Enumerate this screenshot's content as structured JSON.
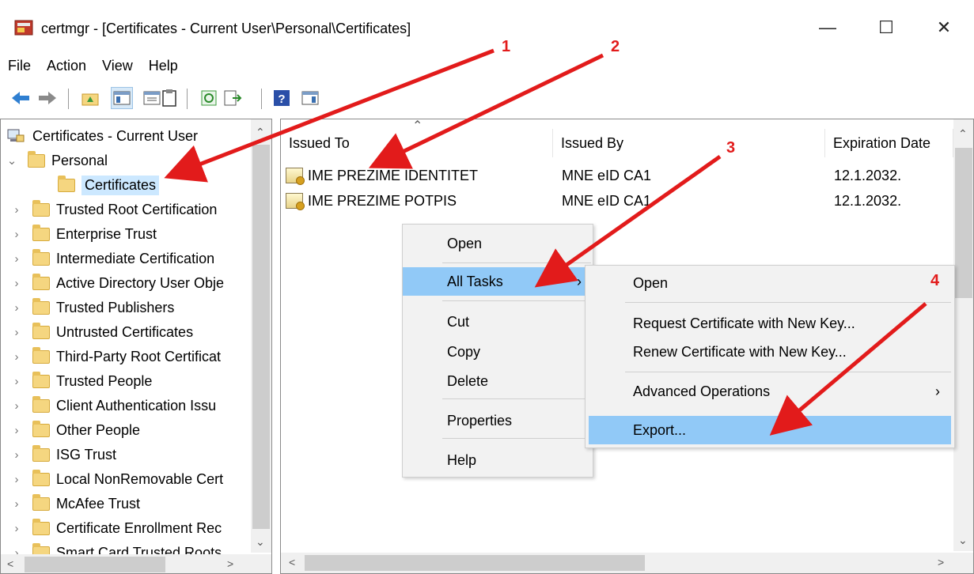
{
  "window": {
    "title": "certmgr - [Certificates - Current User\\Personal\\Certificates]",
    "minimize_glyph": "—",
    "maximize_glyph": "☐",
    "close_glyph": "✕"
  },
  "menubar": [
    "File",
    "Action",
    "View",
    "Help"
  ],
  "toolbar": {
    "icons": [
      "back-icon",
      "forward-icon",
      "up-folder-icon",
      "show-tree-icon",
      "clipboard-icon",
      "refresh-icon",
      "export-list-icon",
      "help-icon",
      "action-pane-icon"
    ]
  },
  "tree": {
    "root": "Certificates - Current User",
    "personal": "Personal",
    "certificates": "Certificates",
    "folders": [
      "Trusted Root Certification",
      "Enterprise Trust",
      "Intermediate Certification",
      "Active Directory User Obje",
      "Trusted Publishers",
      "Untrusted Certificates",
      "Third-Party Root Certificat",
      "Trusted People",
      "Client Authentication Issu",
      "Other People",
      "ISG Trust",
      "Local NonRemovable Cert",
      "McAfee Trust",
      "Certificate Enrollment Rec",
      "Smart Card Trusted Roots"
    ]
  },
  "list": {
    "columns": [
      "Issued To",
      "Issued By",
      "Expiration Date"
    ],
    "rows": [
      {
        "issued_to": "IME PREZIME   IDENTITET",
        "issued_by": "MNE eID CA1",
        "expires": "12.1.2032."
      },
      {
        "issued_to": "IME PREZIME   POTPIS",
        "issued_by": "MNE eID CA1",
        "expires": "12.1.2032."
      }
    ]
  },
  "context_menu": {
    "items": [
      "Open",
      "All Tasks",
      "Cut",
      "Copy",
      "Delete",
      "Properties",
      "Help"
    ],
    "highlighted": "All Tasks"
  },
  "submenu": {
    "items": [
      "Open",
      "Request Certificate with New Key...",
      "Renew Certificate with New Key...",
      "Advanced Operations",
      "Export..."
    ],
    "highlighted": "Export..."
  },
  "annotations": {
    "labels": [
      "1",
      "2",
      "3",
      "4"
    ],
    "color": "#e21b1b"
  },
  "colors": {
    "highlight": "#91c9f7",
    "tree_selected": "#cce8ff",
    "menu_bg": "#f2f2f2"
  }
}
